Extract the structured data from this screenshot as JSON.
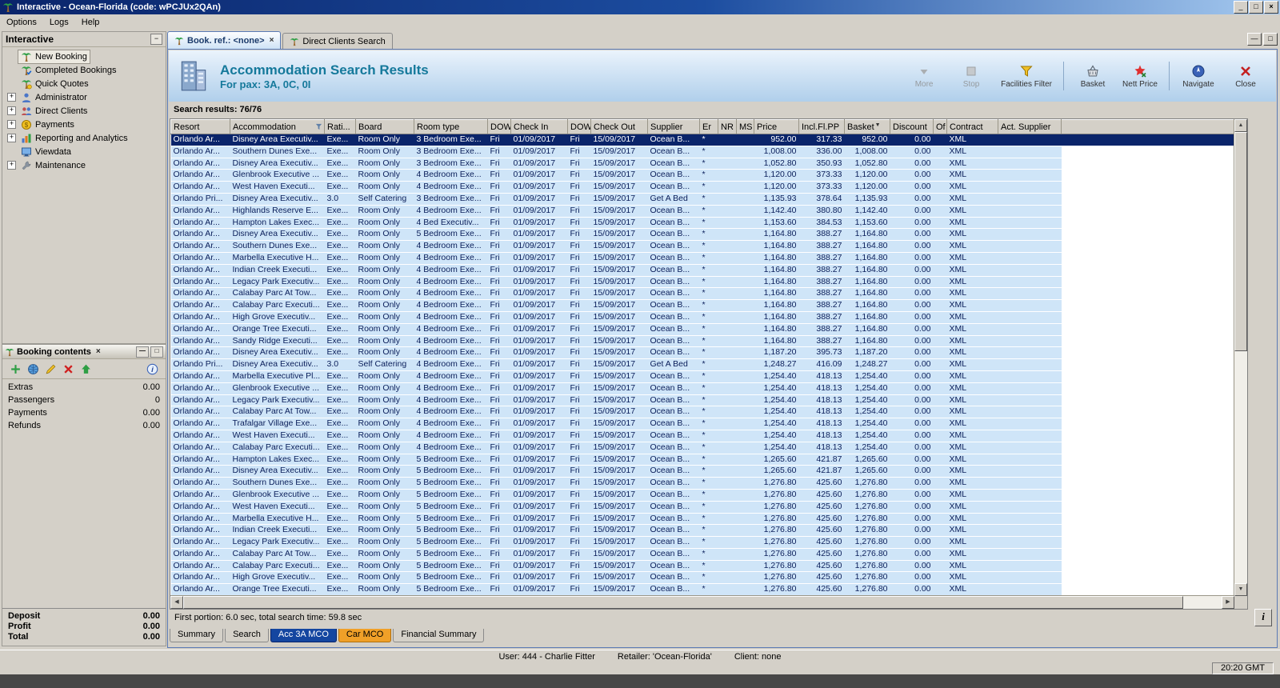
{
  "window": {
    "title": "Interactive - Ocean-Florida (code: wPCJUx2QAn)"
  },
  "menu": {
    "items": [
      "Options",
      "Logs",
      "Help"
    ]
  },
  "sidebar": {
    "title": "Interactive",
    "items": [
      {
        "label": "New Booking",
        "icon": "palm-icon",
        "selected": true,
        "expandable": false
      },
      {
        "label": "Completed Bookings",
        "icon": "palm-check-icon",
        "expandable": false
      },
      {
        "label": "Quick Quotes",
        "icon": "palm-quote-icon",
        "expandable": false
      },
      {
        "label": "Administrator",
        "icon": "administrator-icon",
        "expandable": true
      },
      {
        "label": "Direct Clients",
        "icon": "clients-icon",
        "expandable": true
      },
      {
        "label": "Payments",
        "icon": "payments-icon",
        "expandable": true
      },
      {
        "label": "Reporting and Analytics",
        "icon": "reporting-icon",
        "expandable": true
      },
      {
        "label": "Viewdata",
        "icon": "viewdata-icon",
        "expandable": false
      },
      {
        "label": "Maintenance",
        "icon": "maintenance-icon",
        "expandable": true
      }
    ]
  },
  "booking_contents": {
    "title": "Booking contents",
    "toolbar": [
      "add-icon",
      "globe-icon",
      "edit-icon",
      "delete-icon",
      "move-up-icon",
      "info-icon"
    ],
    "rows": [
      {
        "label": "Extras",
        "value": "0.00"
      },
      {
        "label": "Passengers",
        "value": "0"
      },
      {
        "label": "Payments",
        "value": "0.00"
      },
      {
        "label": "Refunds",
        "value": "0.00"
      }
    ],
    "totals": [
      {
        "label": "Deposit",
        "value": "0.00"
      },
      {
        "label": "Profit",
        "value": "0.00"
      },
      {
        "label": "Total",
        "value": "0.00"
      }
    ]
  },
  "tabs": {
    "items": [
      {
        "label": "Book. ref.: <none>",
        "active": true,
        "closable": true
      },
      {
        "label": "Direct Clients Search",
        "active": false,
        "closable": false
      }
    ]
  },
  "banner": {
    "title": "Accommodation Search Results",
    "subtitle": "For pax: 3A, 0C, 0I",
    "buttons": [
      {
        "label": "More",
        "icon": "more-icon",
        "disabled": true
      },
      {
        "label": "Stop",
        "icon": "stop-icon",
        "disabled": true
      },
      {
        "label": "Facilities Filter",
        "icon": "facilities-filter-icon"
      },
      {
        "separator": true
      },
      {
        "label": "Basket",
        "icon": "basket-icon"
      },
      {
        "label": "Nett Price",
        "icon": "nett-price-icon"
      },
      {
        "separator": true
      },
      {
        "label": "Navigate",
        "icon": "navigate-icon"
      },
      {
        "label": "Close",
        "icon": "close-icon"
      }
    ]
  },
  "results": {
    "summary": "Search results: 76/76",
    "footer": "First portion: 6.0 sec, total search time: 59.8 sec"
  },
  "table": {
    "columns": [
      "Resort",
      "Accommodation",
      "Rati...",
      "Board",
      "Room type",
      "DOW",
      "Check In",
      "DOW",
      "Check Out",
      "Supplier",
      "Er",
      "NR",
      "MS",
      "Price",
      "Incl.Fl.PP",
      "Basket",
      "Discount",
      "Of",
      "Contract",
      "Act. Supplier"
    ],
    "selected_row_index": 0,
    "rows": [
      [
        "Orlando Ar...",
        "Disney Area Executiv...",
        "Exe...",
        "Room Only",
        "3 Bedroom Exe...",
        "Fri",
        "01/09/2017",
        "Fri",
        "15/09/2017",
        "Ocean B...",
        "*",
        "",
        "",
        "952.00",
        "317.33",
        "952.00",
        "0.00",
        "",
        "XML",
        ""
      ],
      [
        "Orlando Ar...",
        "Southern Dunes Exe...",
        "Exe...",
        "Room Only",
        "3 Bedroom Exe...",
        "Fri",
        "01/09/2017",
        "Fri",
        "15/09/2017",
        "Ocean B...",
        "*",
        "",
        "",
        "1,008.00",
        "336.00",
        "1,008.00",
        "0.00",
        "",
        "XML",
        ""
      ],
      [
        "Orlando Ar...",
        "Disney Area Executiv...",
        "Exe...",
        "Room Only",
        "3 Bedroom Exe...",
        "Fri",
        "01/09/2017",
        "Fri",
        "15/09/2017",
        "Ocean B...",
        "*",
        "",
        "",
        "1,052.80",
        "350.93",
        "1,052.80",
        "0.00",
        "",
        "XML",
        ""
      ],
      [
        "Orlando Ar...",
        "Glenbrook Executive ...",
        "Exe...",
        "Room Only",
        "4 Bedroom Exe...",
        "Fri",
        "01/09/2017",
        "Fri",
        "15/09/2017",
        "Ocean B...",
        "*",
        "",
        "",
        "1,120.00",
        "373.33",
        "1,120.00",
        "0.00",
        "",
        "XML",
        ""
      ],
      [
        "Orlando Ar...",
        "West Haven Executi...",
        "Exe...",
        "Room Only",
        "4 Bedroom Exe...",
        "Fri",
        "01/09/2017",
        "Fri",
        "15/09/2017",
        "Ocean B...",
        "*",
        "",
        "",
        "1,120.00",
        "373.33",
        "1,120.00",
        "0.00",
        "",
        "XML",
        ""
      ],
      [
        "Orlando Pri...",
        "Disney Area Executiv...",
        "3.0",
        "Self Catering",
        "3 Bedroom Exe...",
        "Fri",
        "01/09/2017",
        "Fri",
        "15/09/2017",
        "Get A Bed",
        "*",
        "",
        "",
        "1,135.93",
        "378.64",
        "1,135.93",
        "0.00",
        "",
        "XML",
        ""
      ],
      [
        "Orlando Ar...",
        "Highlands Reserve E...",
        "Exe...",
        "Room Only",
        "4 Bedroom Exe...",
        "Fri",
        "01/09/2017",
        "Fri",
        "15/09/2017",
        "Ocean B...",
        "*",
        "",
        "",
        "1,142.40",
        "380.80",
        "1,142.40",
        "0.00",
        "",
        "XML",
        ""
      ],
      [
        "Orlando Ar...",
        "Hampton Lakes Exec...",
        "Exe...",
        "Room Only",
        "4 Bed Executiv...",
        "Fri",
        "01/09/2017",
        "Fri",
        "15/09/2017",
        "Ocean B...",
        "*",
        "",
        "",
        "1,153.60",
        "384.53",
        "1,153.60",
        "0.00",
        "",
        "XML",
        ""
      ],
      [
        "Orlando Ar...",
        "Disney Area Executiv...",
        "Exe...",
        "Room Only",
        "5 Bedroom Exe...",
        "Fri",
        "01/09/2017",
        "Fri",
        "15/09/2017",
        "Ocean B...",
        "*",
        "",
        "",
        "1,164.80",
        "388.27",
        "1,164.80",
        "0.00",
        "",
        "XML",
        ""
      ],
      [
        "Orlando Ar...",
        "Southern Dunes Exe...",
        "Exe...",
        "Room Only",
        "4 Bedroom Exe...",
        "Fri",
        "01/09/2017",
        "Fri",
        "15/09/2017",
        "Ocean B...",
        "*",
        "",
        "",
        "1,164.80",
        "388.27",
        "1,164.80",
        "0.00",
        "",
        "XML",
        ""
      ],
      [
        "Orlando Ar...",
        "Marbella Executive H...",
        "Exe...",
        "Room Only",
        "4 Bedroom Exe...",
        "Fri",
        "01/09/2017",
        "Fri",
        "15/09/2017",
        "Ocean B...",
        "*",
        "",
        "",
        "1,164.80",
        "388.27",
        "1,164.80",
        "0.00",
        "",
        "XML",
        ""
      ],
      [
        "Orlando Ar...",
        "Indian Creek Executi...",
        "Exe...",
        "Room Only",
        "4 Bedroom Exe...",
        "Fri",
        "01/09/2017",
        "Fri",
        "15/09/2017",
        "Ocean B...",
        "*",
        "",
        "",
        "1,164.80",
        "388.27",
        "1,164.80",
        "0.00",
        "",
        "XML",
        ""
      ],
      [
        "Orlando Ar...",
        "Legacy Park Executiv...",
        "Exe...",
        "Room Only",
        "4 Bedroom Exe...",
        "Fri",
        "01/09/2017",
        "Fri",
        "15/09/2017",
        "Ocean B...",
        "*",
        "",
        "",
        "1,164.80",
        "388.27",
        "1,164.80",
        "0.00",
        "",
        "XML",
        ""
      ],
      [
        "Orlando Ar...",
        "Calabay Parc At Tow...",
        "Exe...",
        "Room Only",
        "4 Bedroom Exe...",
        "Fri",
        "01/09/2017",
        "Fri",
        "15/09/2017",
        "Ocean B...",
        "*",
        "",
        "",
        "1,164.80",
        "388.27",
        "1,164.80",
        "0.00",
        "",
        "XML",
        ""
      ],
      [
        "Orlando Ar...",
        "Calabay Parc Executi...",
        "Exe...",
        "Room Only",
        "4 Bedroom Exe...",
        "Fri",
        "01/09/2017",
        "Fri",
        "15/09/2017",
        "Ocean B...",
        "*",
        "",
        "",
        "1,164.80",
        "388.27",
        "1,164.80",
        "0.00",
        "",
        "XML",
        ""
      ],
      [
        "Orlando Ar...",
        "High Grove Executiv...",
        "Exe...",
        "Room Only",
        "4 Bedroom Exe...",
        "Fri",
        "01/09/2017",
        "Fri",
        "15/09/2017",
        "Ocean B...",
        "*",
        "",
        "",
        "1,164.80",
        "388.27",
        "1,164.80",
        "0.00",
        "",
        "XML",
        ""
      ],
      [
        "Orlando Ar...",
        "Orange Tree Executi...",
        "Exe...",
        "Room Only",
        "4 Bedroom Exe...",
        "Fri",
        "01/09/2017",
        "Fri",
        "15/09/2017",
        "Ocean B...",
        "*",
        "",
        "",
        "1,164.80",
        "388.27",
        "1,164.80",
        "0.00",
        "",
        "XML",
        ""
      ],
      [
        "Orlando Ar...",
        "Sandy Ridge Executi...",
        "Exe...",
        "Room Only",
        "4 Bedroom Exe...",
        "Fri",
        "01/09/2017",
        "Fri",
        "15/09/2017",
        "Ocean B...",
        "*",
        "",
        "",
        "1,164.80",
        "388.27",
        "1,164.80",
        "0.00",
        "",
        "XML",
        ""
      ],
      [
        "Orlando Ar...",
        "Disney Area Executiv...",
        "Exe...",
        "Room Only",
        "4 Bedroom Exe...",
        "Fri",
        "01/09/2017",
        "Fri",
        "15/09/2017",
        "Ocean B...",
        "*",
        "",
        "",
        "1,187.20",
        "395.73",
        "1,187.20",
        "0.00",
        "",
        "XML",
        ""
      ],
      [
        "Orlando Pri...",
        "Disney Area Executiv...",
        "3.0",
        "Self Catering",
        "4 Bedroom Exe...",
        "Fri",
        "01/09/2017",
        "Fri",
        "15/09/2017",
        "Get A Bed",
        "*",
        "",
        "",
        "1,248.27",
        "416.09",
        "1,248.27",
        "0.00",
        "",
        "XML",
        ""
      ],
      [
        "Orlando Ar...",
        "Marbella Executive Pl...",
        "Exe...",
        "Room Only",
        "4 Bedroom Exe...",
        "Fri",
        "01/09/2017",
        "Fri",
        "15/09/2017",
        "Ocean B...",
        "*",
        "",
        "",
        "1,254.40",
        "418.13",
        "1,254.40",
        "0.00",
        "",
        "XML",
        ""
      ],
      [
        "Orlando Ar...",
        "Glenbrook Executive ...",
        "Exe...",
        "Room Only",
        "4 Bedroom Exe...",
        "Fri",
        "01/09/2017",
        "Fri",
        "15/09/2017",
        "Ocean B...",
        "*",
        "",
        "",
        "1,254.40",
        "418.13",
        "1,254.40",
        "0.00",
        "",
        "XML",
        ""
      ],
      [
        "Orlando Ar...",
        "Legacy Park Executiv...",
        "Exe...",
        "Room Only",
        "4 Bedroom Exe...",
        "Fri",
        "01/09/2017",
        "Fri",
        "15/09/2017",
        "Ocean B...",
        "*",
        "",
        "",
        "1,254.40",
        "418.13",
        "1,254.40",
        "0.00",
        "",
        "XML",
        ""
      ],
      [
        "Orlando Ar...",
        "Calabay Parc At Tow...",
        "Exe...",
        "Room Only",
        "4 Bedroom Exe...",
        "Fri",
        "01/09/2017",
        "Fri",
        "15/09/2017",
        "Ocean B...",
        "*",
        "",
        "",
        "1,254.40",
        "418.13",
        "1,254.40",
        "0.00",
        "",
        "XML",
        ""
      ],
      [
        "Orlando Ar...",
        "Trafalgar Village Exe...",
        "Exe...",
        "Room Only",
        "4 Bedroom Exe...",
        "Fri",
        "01/09/2017",
        "Fri",
        "15/09/2017",
        "Ocean B...",
        "*",
        "",
        "",
        "1,254.40",
        "418.13",
        "1,254.40",
        "0.00",
        "",
        "XML",
        ""
      ],
      [
        "Orlando Ar...",
        "West Haven Executi...",
        "Exe...",
        "Room Only",
        "4 Bedroom Exe...",
        "Fri",
        "01/09/2017",
        "Fri",
        "15/09/2017",
        "Ocean B...",
        "*",
        "",
        "",
        "1,254.40",
        "418.13",
        "1,254.40",
        "0.00",
        "",
        "XML",
        ""
      ],
      [
        "Orlando Ar...",
        "Calabay Parc Executi...",
        "Exe...",
        "Room Only",
        "4 Bedroom Exe...",
        "Fri",
        "01/09/2017",
        "Fri",
        "15/09/2017",
        "Ocean B...",
        "*",
        "",
        "",
        "1,254.40",
        "418.13",
        "1,254.40",
        "0.00",
        "",
        "XML",
        ""
      ],
      [
        "Orlando Ar...",
        "Hampton Lakes Exec...",
        "Exe...",
        "Room Only",
        "5 Bedroom Exe...",
        "Fri",
        "01/09/2017",
        "Fri",
        "15/09/2017",
        "Ocean B...",
        "*",
        "",
        "",
        "1,265.60",
        "421.87",
        "1,265.60",
        "0.00",
        "",
        "XML",
        ""
      ],
      [
        "Orlando Ar...",
        "Disney Area Executiv...",
        "Exe...",
        "Room Only",
        "5 Bedroom Exe...",
        "Fri",
        "01/09/2017",
        "Fri",
        "15/09/2017",
        "Ocean B...",
        "*",
        "",
        "",
        "1,265.60",
        "421.87",
        "1,265.60",
        "0.00",
        "",
        "XML",
        ""
      ],
      [
        "Orlando Ar...",
        "Southern Dunes Exe...",
        "Exe...",
        "Room Only",
        "5 Bedroom Exe...",
        "Fri",
        "01/09/2017",
        "Fri",
        "15/09/2017",
        "Ocean B...",
        "*",
        "",
        "",
        "1,276.80",
        "425.60",
        "1,276.80",
        "0.00",
        "",
        "XML",
        ""
      ],
      [
        "Orlando Ar...",
        "Glenbrook Executive ...",
        "Exe...",
        "Room Only",
        "5 Bedroom Exe...",
        "Fri",
        "01/09/2017",
        "Fri",
        "15/09/2017",
        "Ocean B...",
        "*",
        "",
        "",
        "1,276.80",
        "425.60",
        "1,276.80",
        "0.00",
        "",
        "XML",
        ""
      ],
      [
        "Orlando Ar...",
        "West Haven Executi...",
        "Exe...",
        "Room Only",
        "5 Bedroom Exe...",
        "Fri",
        "01/09/2017",
        "Fri",
        "15/09/2017",
        "Ocean B...",
        "*",
        "",
        "",
        "1,276.80",
        "425.60",
        "1,276.80",
        "0.00",
        "",
        "XML",
        ""
      ],
      [
        "Orlando Ar...",
        "Marbella Executive H...",
        "Exe...",
        "Room Only",
        "5 Bedroom Exe...",
        "Fri",
        "01/09/2017",
        "Fri",
        "15/09/2017",
        "Ocean B...",
        "*",
        "",
        "",
        "1,276.80",
        "425.60",
        "1,276.80",
        "0.00",
        "",
        "XML",
        ""
      ],
      [
        "Orlando Ar...",
        "Indian Creek Executi...",
        "Exe...",
        "Room Only",
        "5 Bedroom Exe...",
        "Fri",
        "01/09/2017",
        "Fri",
        "15/09/2017",
        "Ocean B...",
        "*",
        "",
        "",
        "1,276.80",
        "425.60",
        "1,276.80",
        "0.00",
        "",
        "XML",
        ""
      ],
      [
        "Orlando Ar...",
        "Legacy Park Executiv...",
        "Exe...",
        "Room Only",
        "5 Bedroom Exe...",
        "Fri",
        "01/09/2017",
        "Fri",
        "15/09/2017",
        "Ocean B...",
        "*",
        "",
        "",
        "1,276.80",
        "425.60",
        "1,276.80",
        "0.00",
        "",
        "XML",
        ""
      ],
      [
        "Orlando Ar...",
        "Calabay Parc At Tow...",
        "Exe...",
        "Room Only",
        "5 Bedroom Exe...",
        "Fri",
        "01/09/2017",
        "Fri",
        "15/09/2017",
        "Ocean B...",
        "*",
        "",
        "",
        "1,276.80",
        "425.60",
        "1,276.80",
        "0.00",
        "",
        "XML",
        ""
      ],
      [
        "Orlando Ar...",
        "Calabay Parc Executi...",
        "Exe...",
        "Room Only",
        "5 Bedroom Exe...",
        "Fri",
        "01/09/2017",
        "Fri",
        "15/09/2017",
        "Ocean B...",
        "*",
        "",
        "",
        "1,276.80",
        "425.60",
        "1,276.80",
        "0.00",
        "",
        "XML",
        ""
      ],
      [
        "Orlando Ar...",
        "High Grove Executiv...",
        "Exe...",
        "Room Only",
        "5 Bedroom Exe...",
        "Fri",
        "01/09/2017",
        "Fri",
        "15/09/2017",
        "Ocean B...",
        "*",
        "",
        "",
        "1,276.80",
        "425.60",
        "1,276.80",
        "0.00",
        "",
        "XML",
        ""
      ],
      [
        "Orlando Ar...",
        "Orange Tree Executi...",
        "Exe...",
        "Room Only",
        "5 Bedroom Exe...",
        "Fri",
        "01/09/2017",
        "Fri",
        "15/09/2017",
        "Ocean B...",
        "*",
        "",
        "",
        "1,276.80",
        "425.60",
        "1,276.80",
        "0.00",
        "",
        "XML",
        ""
      ]
    ]
  },
  "bottom_tabs": {
    "items": [
      {
        "label": "Summary"
      },
      {
        "label": "Search"
      },
      {
        "label": "Acc 3A MCO",
        "style": "active-blue"
      },
      {
        "label": "Car MCO",
        "style": "highlight-orange"
      },
      {
        "label": "Financial Summary"
      }
    ]
  },
  "status_bar": {
    "user": "User: 444 - Charlie Fitter",
    "retailer": "Retailer: 'Ocean-Florida'",
    "client": "Client: none",
    "time": "20:20 GMT"
  }
}
